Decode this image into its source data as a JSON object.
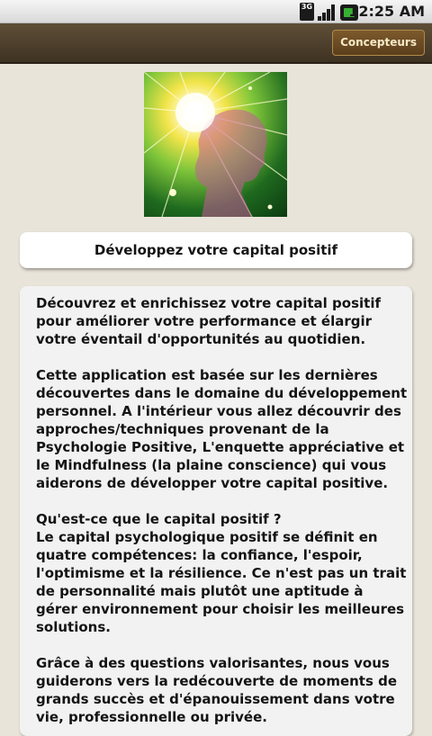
{
  "status_bar": {
    "network_type": "3G",
    "time": "12:25 AM"
  },
  "title_bar": {
    "designers_button": "Concepteurs"
  },
  "hero": {
    "icon": "glowing-head-image"
  },
  "subtitle": "Développez votre capital positif",
  "body": {
    "paragraphs": [
      [
        "Découvrez et enrichissez votre capital positif",
        "pour améliorer votre performance et élargir",
        "votre éventail d'opportunités au quotidien."
      ],
      [
        "Cette application est basée sur les dernières",
        "découvertes dans le domaine du développement",
        "personnel. A l'intérieur vous allez découvrir des",
        "approches/techniques provenant de la",
        "Psychologie Positive, L'enquette appréciative et",
        "le Mindfulness (la plaine conscience) qui vous",
        "aiderons de développer votre capital positive."
      ],
      [
        "Qu'est-ce que le capital positif ?",
        "Le capital psychologique positif se définit en",
        "quatre compétences: la confiance, l'espoir,",
        "l'optimisme et la résilience. Ce n'est pas un trait",
        "de personnalité mais plutôt une aptitude à",
        "gérer environnement pour choisir les meilleures",
        "solutions."
      ],
      [
        "Grâce à des questions valorisantes, nous vous",
        "guiderons vers la redécouverte de moments de",
        "grands succès et d'épanouissement dans votre",
        "vie, professionnelle ou privée."
      ]
    ]
  }
}
